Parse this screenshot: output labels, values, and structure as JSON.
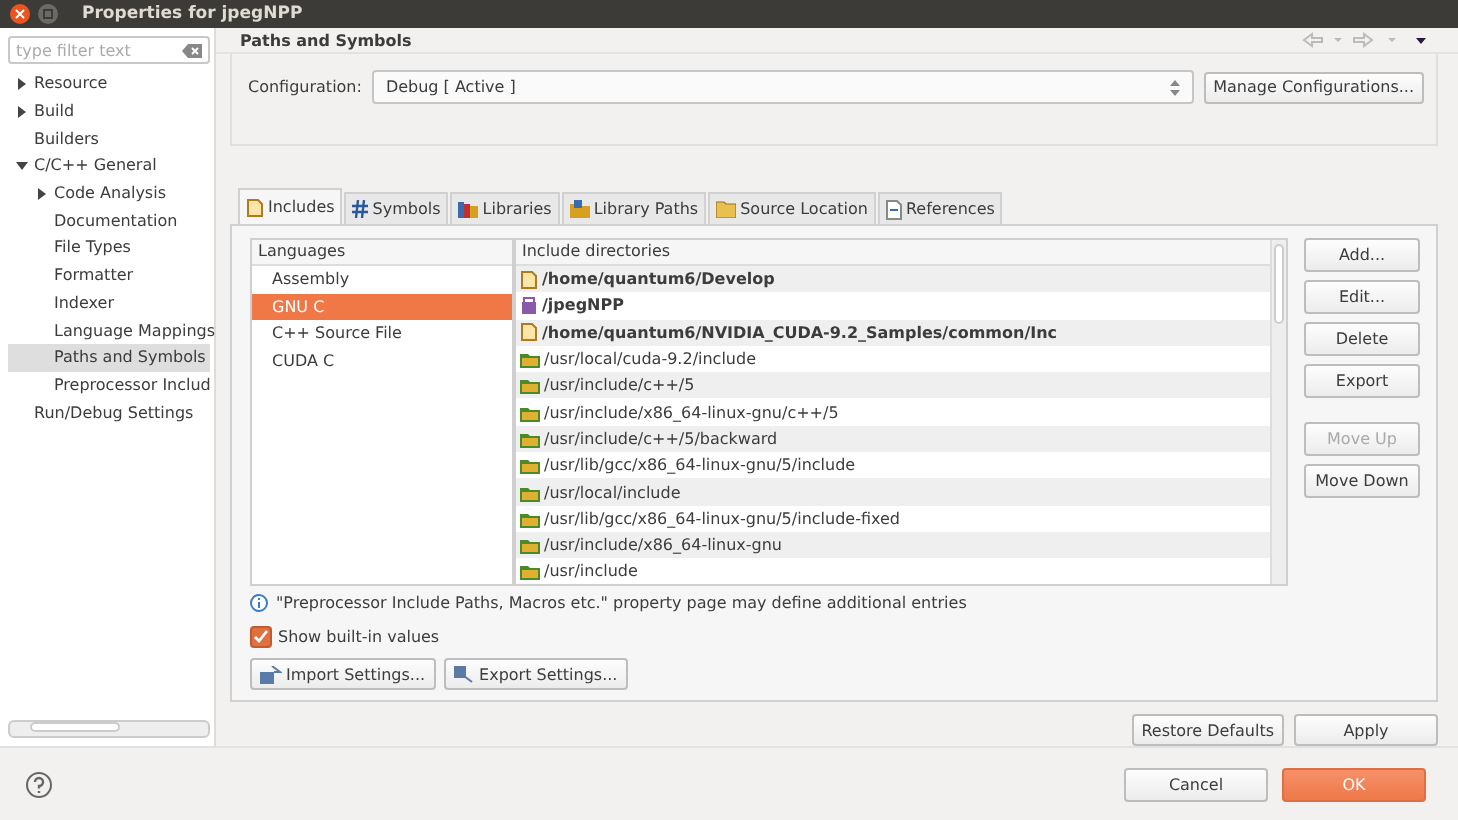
{
  "window": {
    "title": "Properties for jpegNPP"
  },
  "sidebar": {
    "filter": {
      "placeholder": "type filter text"
    },
    "items": [
      {
        "label": "Resource",
        "expanded": false,
        "selected": false
      },
      {
        "label": "Build",
        "expanded": false,
        "selected": false
      },
      {
        "label": "Builders",
        "selected": false
      },
      {
        "label": "C/C++ General",
        "expanded": true,
        "selected": false,
        "children": [
          {
            "label": "Code Analysis",
            "expanded": false,
            "selected": false
          },
          {
            "label": "Documentation",
            "selected": false
          },
          {
            "label": "File Types",
            "selected": false
          },
          {
            "label": "Formatter",
            "selected": false
          },
          {
            "label": "Indexer",
            "selected": false
          },
          {
            "label": "Language Mappings",
            "selected": false
          },
          {
            "label": "Paths and Symbols",
            "selected": true
          },
          {
            "label": "Preprocessor Includ",
            "selected": false
          }
        ]
      },
      {
        "label": "Run/Debug Settings",
        "selected": false
      }
    ]
  },
  "page": {
    "title": "Paths and Symbols",
    "configuration": {
      "label": "Configuration:",
      "value": "Debug  [ Active ]",
      "button": "Manage Configurations..."
    },
    "tabs": [
      {
        "label": "Includes",
        "kind": "includes",
        "selected": true
      },
      {
        "label": "Symbols",
        "kind": "symbols",
        "selected": false
      },
      {
        "label": "Libraries",
        "kind": "libraries",
        "selected": false
      },
      {
        "label": "Library Paths",
        "kind": "library-paths",
        "selected": false
      },
      {
        "label": "Source Location",
        "kind": "source",
        "selected": false
      },
      {
        "label": "References",
        "kind": "references",
        "selected": false
      }
    ],
    "languages": {
      "heading": "Languages",
      "items": [
        {
          "label": "Assembly",
          "selected": false
        },
        {
          "label": "GNU C",
          "selected": true
        },
        {
          "label": "C++ Source File",
          "selected": false
        },
        {
          "label": "CUDA C",
          "selected": false
        }
      ]
    },
    "includes": {
      "heading": "Include directories",
      "rows": [
        {
          "path": "/home/quantum6/Develop",
          "kind": "project"
        },
        {
          "path": "/jpegNPP",
          "kind": "workspace"
        },
        {
          "path": "/home/quantum6/NVIDIA_CUDA-9.2_Samples/common/Inc",
          "kind": "project"
        },
        {
          "path": "/usr/local/cuda-9.2/include",
          "kind": "builtin"
        },
        {
          "path": "/usr/include/c++/5",
          "kind": "builtin"
        },
        {
          "path": "/usr/include/x86_64-linux-gnu/c++/5",
          "kind": "builtin"
        },
        {
          "path": "/usr/include/c++/5/backward",
          "kind": "builtin"
        },
        {
          "path": "/usr/lib/gcc/x86_64-linux-gnu/5/include",
          "kind": "builtin"
        },
        {
          "path": "/usr/local/include",
          "kind": "builtin"
        },
        {
          "path": "/usr/lib/gcc/x86_64-linux-gnu/5/include-fixed",
          "kind": "builtin"
        },
        {
          "path": "/usr/include/x86_64-linux-gnu",
          "kind": "builtin"
        },
        {
          "path": "/usr/include",
          "kind": "builtin"
        }
      ]
    },
    "side_buttons": [
      {
        "label": "Add...",
        "disabled": false
      },
      {
        "label": "Edit...",
        "disabled": false
      },
      {
        "label": "Delete",
        "disabled": false
      },
      {
        "label": "Export",
        "disabled": false
      },
      {
        "label": "Move Up",
        "disabled": true
      },
      {
        "label": "Move Down",
        "disabled": false
      }
    ],
    "note": "\"Preprocessor Include Paths, Macros etc.\" property page may define additional entries",
    "show_builtin": {
      "label": "Show built-in values",
      "checked": true
    },
    "import_button": "Import Settings...",
    "export_button": "Export Settings...",
    "restore_button": "Restore Defaults",
    "apply_button": "Apply"
  },
  "footer": {
    "cancel": "Cancel",
    "ok": "OK"
  }
}
